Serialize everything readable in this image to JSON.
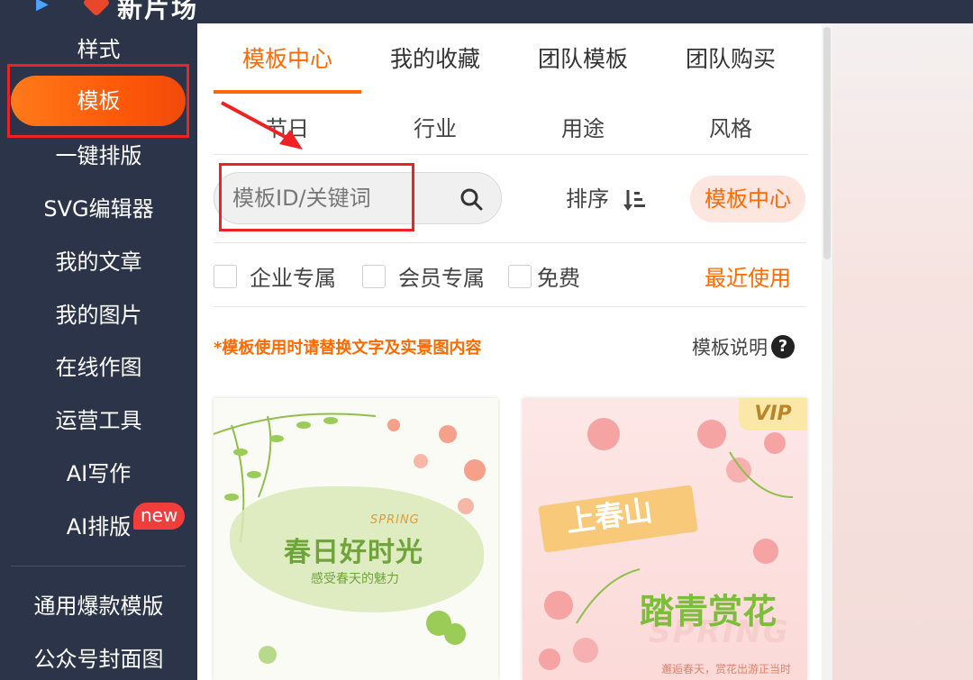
{
  "app": {
    "title": "新片场"
  },
  "sidebar": {
    "items": [
      {
        "label": "样式"
      },
      {
        "label": "模板"
      },
      {
        "label": "一键排版"
      },
      {
        "label": "SVG编辑器"
      },
      {
        "label": "我的文章"
      },
      {
        "label": "我的图片"
      },
      {
        "label": "在线作图"
      },
      {
        "label": "运营工具"
      },
      {
        "label": "AI写作"
      },
      {
        "label": "AI排版"
      },
      {
        "label": "通用爆款模版"
      },
      {
        "label": "公众号封面图"
      }
    ],
    "new_badge": "new",
    "active_index": 1
  },
  "tabs": [
    {
      "label": "模板中心"
    },
    {
      "label": "我的收藏"
    },
    {
      "label": "团队模板"
    },
    {
      "label": "团队购买"
    }
  ],
  "categories": [
    {
      "label": "节日"
    },
    {
      "label": "行业"
    },
    {
      "label": "用途"
    },
    {
      "label": "风格"
    }
  ],
  "search": {
    "placeholder": "模板ID/关键词"
  },
  "sort": {
    "label": "排序"
  },
  "center_button": {
    "label": "模板中心"
  },
  "filters": [
    {
      "label": "企业专属",
      "checked": false
    },
    {
      "label": "会员专属",
      "checked": false
    },
    {
      "label": "免费",
      "checked": false
    }
  ],
  "recent": {
    "label": "最近使用"
  },
  "notice": "*模板使用时请替换文字及实景图内容",
  "help": {
    "label": "模板说明",
    "icon": "?"
  },
  "cards": [
    {
      "spring": "SPRING",
      "title": "春日好时光",
      "subtitle": "感受春天的魅力"
    },
    {
      "vip": "VIP",
      "ribbon": "上春山",
      "title": "踏青赏花",
      "spring": "SPRING",
      "subtitle": "邂逅春天，赏花出游正当时"
    }
  ],
  "colors": {
    "accent": "#ff6a00",
    "sidebar_bg": "#2b3448",
    "highlight_box": "#ee2222"
  }
}
